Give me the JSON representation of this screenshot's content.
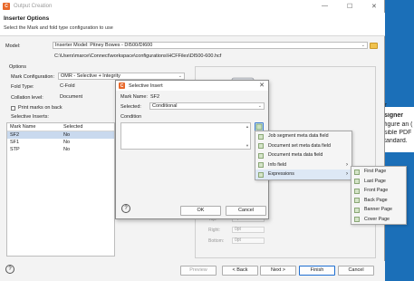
{
  "window": {
    "title": "Output Creation",
    "controls": [
      "—",
      "☐",
      "✕"
    ]
  },
  "header": {
    "title": "Inserter Options",
    "subtitle": "Select the Mark and fold type configuration to use"
  },
  "model": {
    "label": "Model:",
    "value": "Inserter Model: Pitney Bowes - DI500/DI600",
    "path": "C:\\Users\\marce\\Connect\\workspace\\configurations\\HCFFiles\\DI500-600.hcf"
  },
  "options": {
    "group_label": "Options",
    "mark_config_label": "Mark Configuration:",
    "mark_config_value": "OMR - Selective + Integrity",
    "fold_type_label": "Fold Type:",
    "fold_type_value": "C-Fold",
    "collation_label": "Collation level:",
    "collation_value": "Document",
    "print_marks_label": "Print marks on back",
    "selective_inserts_label": "Selective Inserts:"
  },
  "inserts_table": {
    "columns": [
      "Mark Name",
      "Selected"
    ],
    "rows": [
      [
        "SF2",
        "No"
      ],
      [
        "SF1",
        "No"
      ],
      [
        "STP",
        "No"
      ]
    ]
  },
  "preview": {
    "margins": [
      {
        "label": "Top:",
        "value": "0pt"
      },
      {
        "label": "Right:",
        "value": "0pt"
      },
      {
        "label": "Bottom:",
        "value": "0pt"
      }
    ]
  },
  "background_text": [
    "r",
    "signer",
    "figure an (",
    "sible PDF",
    "tandard."
  ],
  "dialog": {
    "title": "Selective Insert",
    "mark_name_label": "Mark Name:",
    "mark_name_value": "SF2",
    "selected_label": "Selected:",
    "selected_value": "Conditional",
    "condition_label": "Condition",
    "ok": "OK",
    "cancel": "Cancel"
  },
  "context_menu": {
    "items": [
      {
        "label": "Job segment meta data field"
      },
      {
        "label": "Document set meta data field"
      },
      {
        "label": "Document meta data field"
      },
      {
        "label": "Info field",
        "submenu": true
      },
      {
        "label": "Expressions",
        "submenu": true
      }
    ]
  },
  "submenu": {
    "items": [
      "First Page",
      "Last Page",
      "Front Page",
      "Back Page",
      "Banner Page",
      "Cover Page"
    ]
  },
  "footer": {
    "preview": "Preview",
    "back": "< Back",
    "next": "Next >",
    "finish": "Finish",
    "cancel": "Cancel"
  },
  "colors": {
    "accent_blue": "#1b6fb8",
    "app_orange": "#e8682a",
    "selection": "#c9d9ee"
  }
}
